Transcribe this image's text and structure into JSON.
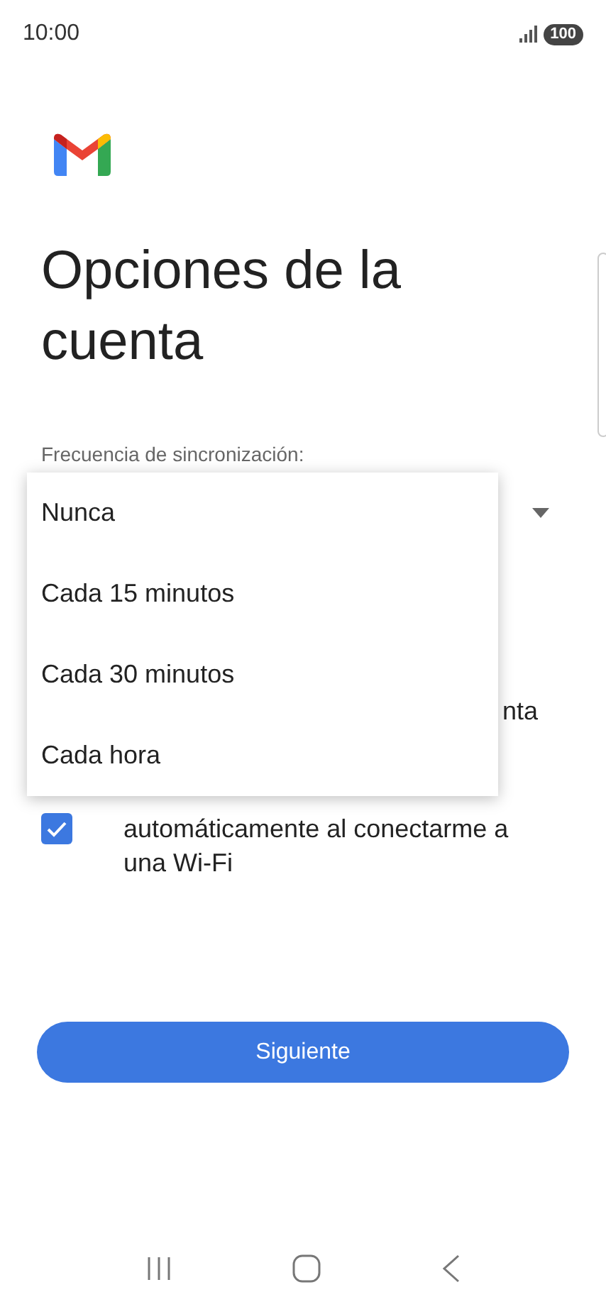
{
  "status_bar": {
    "time": "10:00",
    "battery": "100"
  },
  "title": "Opciones de la cuenta",
  "sync_frequency": {
    "label": "Frecuencia de sincronización:"
  },
  "options": [
    {
      "kind": "fragment",
      "text": "nta"
    },
    {
      "kind": "checkbox",
      "checked": true,
      "text": "automáticamente al conectarme a una Wi-Fi"
    }
  ],
  "dropdown_menu": [
    {
      "label": "Nunca"
    },
    {
      "label": "Cada 15 minutos"
    },
    {
      "label": "Cada 30 minutos"
    },
    {
      "label": "Cada hora"
    }
  ],
  "next_button": "Siguiente"
}
